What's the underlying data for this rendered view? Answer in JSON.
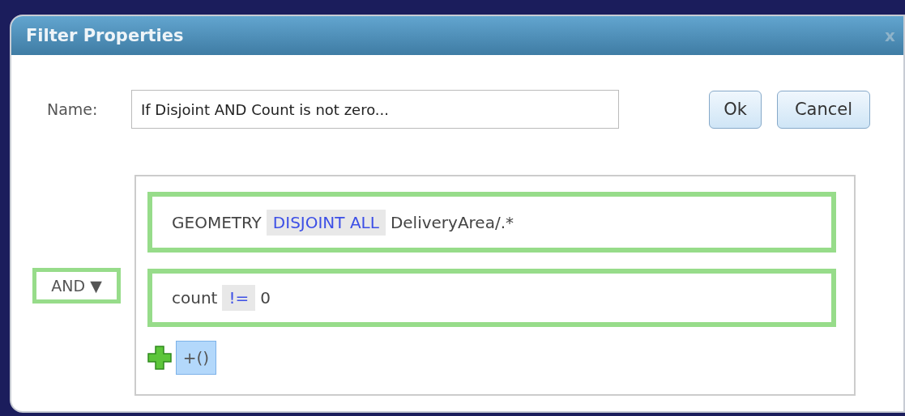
{
  "window": {
    "title": "Filter Properties",
    "close": "x"
  },
  "name_field": {
    "label": "Name:",
    "value": "If Disjoint AND Count is not zero..."
  },
  "buttons": [
    "Ok",
    "Cancel"
  ],
  "logic": {
    "operator": "AND",
    "caret": "▼"
  },
  "clauses": [
    {
      "parts": [
        {
          "kind": "field",
          "text": "GEOMETRY"
        },
        {
          "kind": "operator",
          "text": "DISJOINT ALL"
        },
        {
          "kind": "value",
          "text": "DeliveryArea/.*"
        }
      ]
    },
    {
      "parts": [
        {
          "kind": "field",
          "text": "count"
        },
        {
          "kind": "operator",
          "text": "!="
        },
        {
          "kind": "value",
          "text": "0"
        }
      ]
    }
  ],
  "add_group": {
    "label": "+()"
  }
}
